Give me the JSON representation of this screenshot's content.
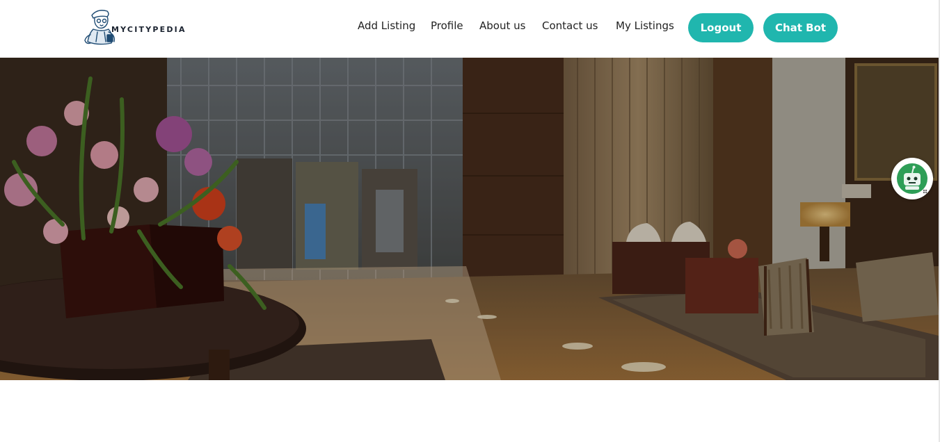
{
  "header": {
    "logo_text": "MYCITYPEDIA",
    "nav": [
      {
        "label": "Add Listing"
      },
      {
        "label": "Profile"
      },
      {
        "label": "About us"
      },
      {
        "label": "Contact us"
      },
      {
        "label": "My Listings"
      }
    ],
    "logout_label": "Logout",
    "chatbot_label": "Chat Bot"
  },
  "hero": {
    "image": "hotel-lobby-image"
  },
  "chatbot_fab": {
    "icon": "robot-icon"
  },
  "colors": {
    "accent": "#20b6ae",
    "nav_text": "#222222",
    "background": "#ffffff"
  }
}
